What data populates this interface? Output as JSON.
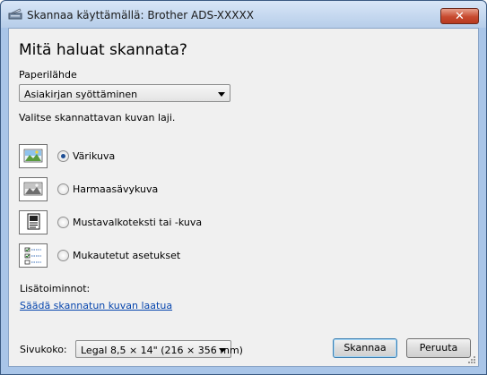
{
  "window": {
    "title": "Skannaa käyttämällä: Brother ADS-XXXXX",
    "close_label": "✕"
  },
  "heading": "Mitä haluat skannata?",
  "paper_source": {
    "label": "Paperilähde",
    "value": "Asiakirjan syöttäminen"
  },
  "picture_type_prompt": "Valitse skannattavan kuvan laji.",
  "options": [
    {
      "label": "Värikuva",
      "checked": true,
      "icon": "color-photo-icon"
    },
    {
      "label": "Harmaasävykuva",
      "checked": false,
      "icon": "grayscale-photo-icon"
    },
    {
      "label": "Mustavalkoteksti tai -kuva",
      "checked": false,
      "icon": "black-white-text-icon"
    },
    {
      "label": "Mukautetut asetukset",
      "checked": false,
      "icon": "custom-settings-icon"
    }
  ],
  "additional_options": {
    "label": "Lisätoiminnot:",
    "link": "Säädä skannatun kuvan laatua"
  },
  "page_size": {
    "label": "Sivukoko:",
    "value": "Legal 8,5 × 14\" (216 × 356 mm)"
  },
  "buttons": {
    "scan": "Skannaa",
    "cancel": "Peruuta"
  },
  "colors": {
    "title_bar": "#b6cde9",
    "close_button": "#c74a2f",
    "link": "#0645ad",
    "radio_dot": "#1e4e94"
  }
}
